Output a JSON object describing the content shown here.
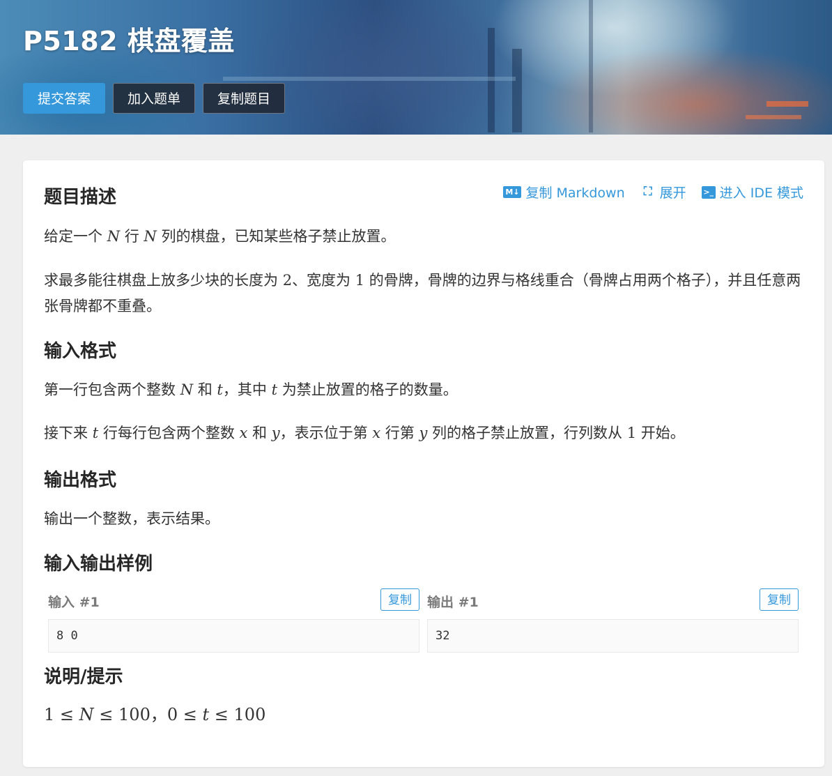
{
  "header": {
    "title": "P5182 棋盘覆盖",
    "buttons": {
      "submit": "提交答案",
      "add_to_list": "加入题单",
      "copy_problem": "复制题目"
    }
  },
  "toolbar": {
    "copy_markdown": "复制 Markdown",
    "expand": "展开",
    "ide_mode": "进入 IDE 模式"
  },
  "sections": {
    "description": {
      "title": "题目描述",
      "p1": [
        "给定一个 ",
        "N",
        " 行 ",
        "N",
        " 列的棋盘，已知某些格子禁止放置。"
      ],
      "p2": [
        "求最多能往棋盘上放多少块的长度为 ",
        "2",
        "、宽度为 ",
        "1",
        " 的骨牌，骨牌的边界与格线重合（骨牌占用两个格子），并且任意两张骨牌都不重叠。"
      ]
    },
    "input": {
      "title": "输入格式",
      "p1": [
        "第一行包含两个整数 ",
        "N",
        " 和 ",
        "t",
        "，其中 ",
        "t",
        " 为禁止放置的格子的数量。"
      ],
      "p2": [
        "接下来 ",
        "t",
        " 行每行包含两个整数 ",
        "x",
        " 和 ",
        "y",
        "，表示位于第 ",
        "x",
        " 行第 ",
        "y",
        " 列的格子禁止放置，行列数从 ",
        "1",
        " 开始。"
      ]
    },
    "output": {
      "title": "输出格式",
      "p1": "输出一个整数，表示结果。"
    },
    "samples": {
      "title": "输入输出样例",
      "input_label": "输入 #1",
      "output_label": "输出 #1",
      "copy_label": "复制",
      "input_value": "8 0",
      "output_value": "32"
    },
    "hint": {
      "title": "说明/提示",
      "p1": [
        "1",
        " ≤ ",
        "N",
        " ≤ ",
        "100",
        "，",
        "0",
        " ≤ ",
        "t",
        " ≤ ",
        "100"
      ]
    }
  }
}
